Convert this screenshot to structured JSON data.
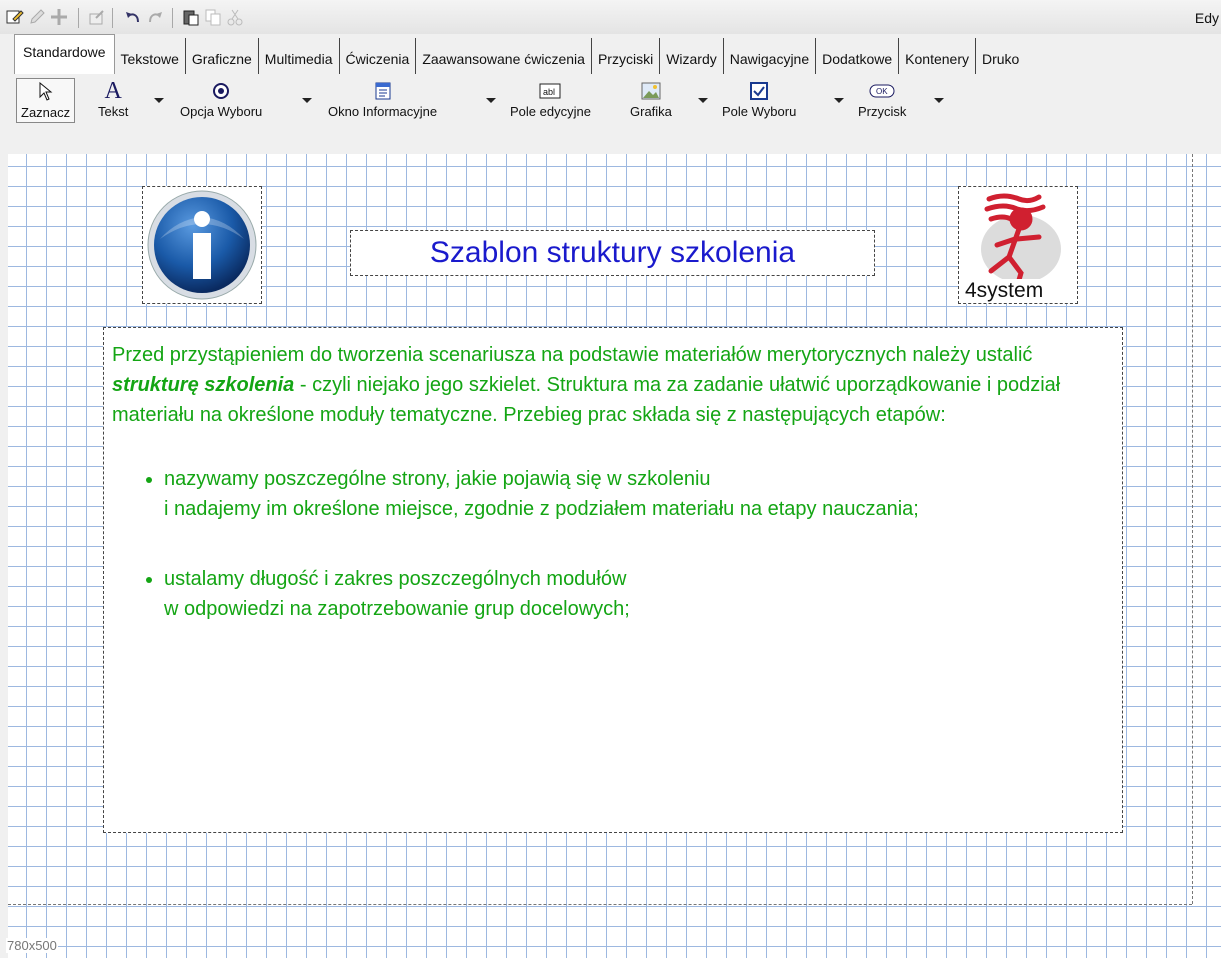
{
  "window": {
    "title_fragment": "Edy"
  },
  "quickbar": {
    "icons": [
      "edit-mode-icon",
      "pencil-icon",
      "move-icon",
      "export-icon",
      "undo-icon",
      "redo-icon",
      "paste-icon",
      "copy-icon",
      "cut-icon"
    ]
  },
  "tabs": [
    "Standardowe",
    "Tekstowe",
    "Graficzne",
    "Multimedia",
    "Ćwiczenia",
    "Zaawansowane ćwiczenia",
    "Przyciski",
    "Wizardy",
    "Nawigacyjne",
    "Dodatkowe",
    "Kontenery",
    "Druko"
  ],
  "active_tab": "Standardowe",
  "toolbar": {
    "select": "Zaznacz",
    "text": "Tekst",
    "radio": "Opcja Wyboru",
    "info_window": "Okno Informacyjne",
    "edit_field": "Pole edycyjne",
    "image": "Grafika",
    "checkbox": "Pole Wyboru",
    "button": "Przycisk"
  },
  "canvas": {
    "title": "Szablon struktury szkolenia",
    "logo_text": "4system",
    "button_icon_text": "OK",
    "size_label": "780x500",
    "intro_part1": "Przed przystąpieniem do tworzenia scenariusza na podstawie materiałów merytorycznych należy ustalić ",
    "intro_bold": "strukturę szkolenia",
    "intro_part2": " - czyli niejako jego szkielet. Struktura ma za zadanie ułatwić uporządkowanie i podział materiału na określone moduły tematyczne. Przebieg prac składa się z następujących etapów:",
    "bullets": [
      {
        "line1": "nazywamy poszczególne strony, jakie pojawią się w szkoleniu",
        "line2": "i nadajemy im określone miejsce, zgodnie z podziałem materiału na etapy nauczania;"
      },
      {
        "line1": "ustalamy długość i zakres poszczególnych modułów",
        "line2": "w odpowiedzi na zapotrzebowanie grup docelowych;"
      }
    ],
    "colors": {
      "text": "#14a514",
      "title": "#1a1acc",
      "grid": "#9db8e0"
    }
  }
}
